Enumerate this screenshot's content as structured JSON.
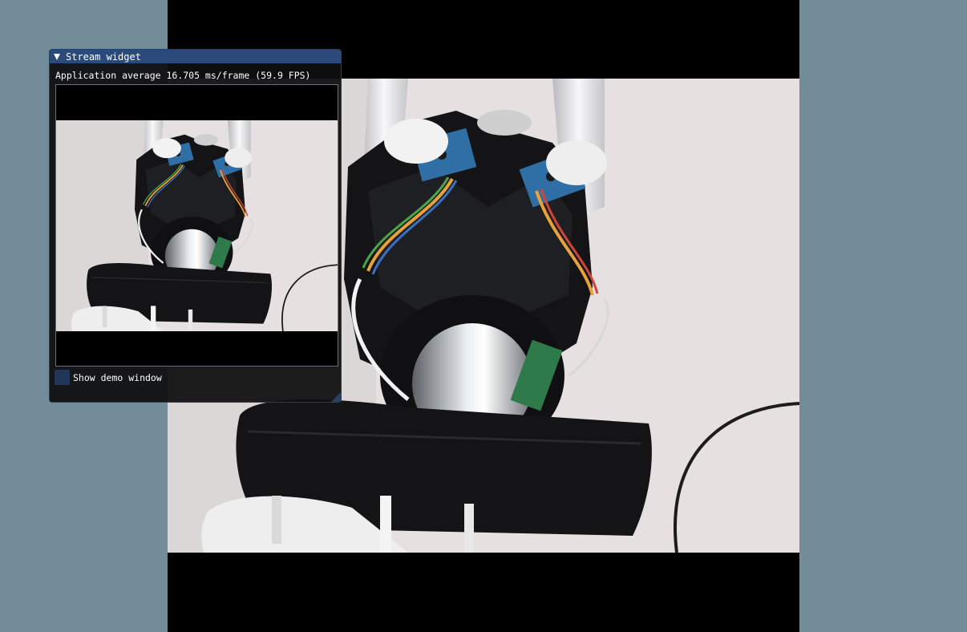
{
  "window": {
    "title": "Stream widget",
    "stats": "Application average 16.705 ms/frame (59.9 FPS)",
    "checkbox_label": "Show demo window",
    "checkbox_checked": false
  },
  "colors": {
    "background": "#738c99",
    "title_bar": "#294a7a",
    "checkbox": "#223658",
    "window_bg": "#0f0f0f"
  },
  "icons": {
    "collapse": "triangle-down-icon"
  }
}
